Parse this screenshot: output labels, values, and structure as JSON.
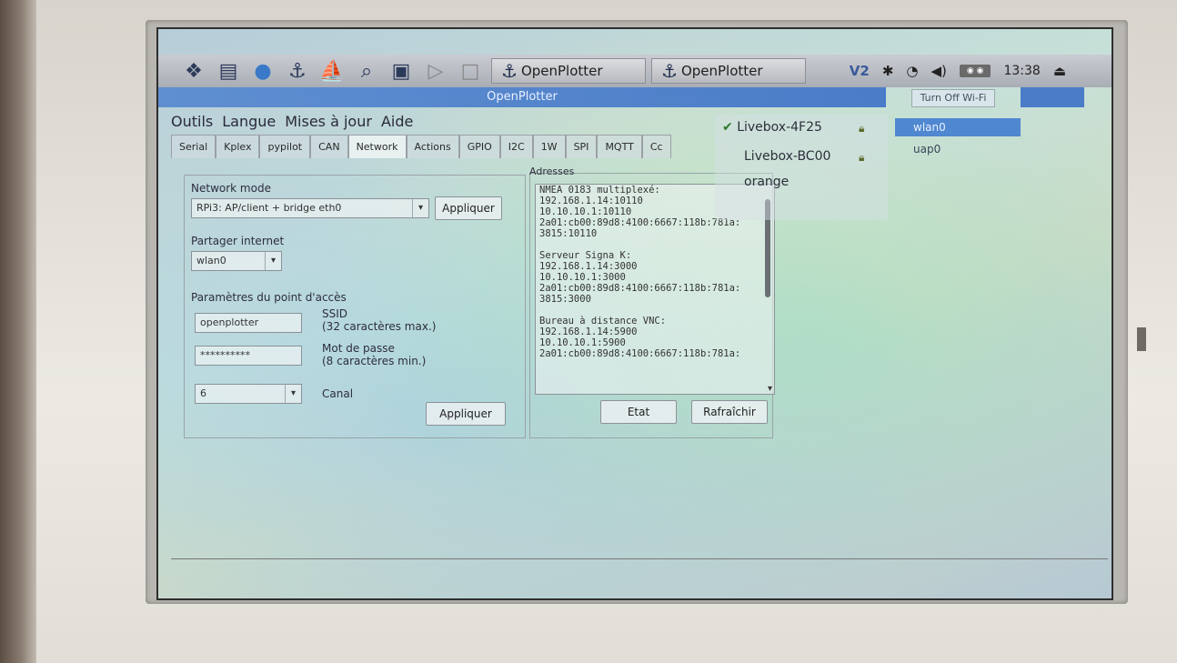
{
  "taskbar": {
    "task1": "OpenPlotter",
    "task2": "OpenPlotter",
    "tray_badge": "◉ ◉",
    "clock": "13:38"
  },
  "window": {
    "title": "OpenPlotter",
    "menu": [
      "Outils",
      "Langue",
      "Mises à jour",
      "Aide"
    ],
    "tabs": [
      "Serial",
      "Kplex",
      "pypilot",
      "CAN",
      "Network",
      "Actions",
      "GPIO",
      "I2C",
      "1W",
      "SPI",
      "MQTT",
      "Cc"
    ],
    "active_tab": "Network"
  },
  "network": {
    "mode_label": "Network mode",
    "mode_value": "RPi3: AP/client + bridge eth0",
    "apply_top": "Appliquer",
    "share_label": "Partager internet",
    "share_value": "wlan0",
    "ap_params_label": "Paramètres du point d'accès",
    "ssid_value": "openplotter",
    "ssid_label_1": "SSID",
    "ssid_label_2": "(32 caractères max.)",
    "password_value": "**********",
    "password_label_1": "Mot de passe",
    "password_label_2": "(8 caractères min.)",
    "channel_value": "6",
    "channel_label": "Canal",
    "apply_bottom": "Appliquer"
  },
  "addresses": {
    "legend": "Adresses",
    "lines": [
      "NMEA 0183 multiplexé:",
      "192.168.1.14:10110",
      "10.10.10.1:10110",
      "2a01:cb00:89d8:4100:6667:118b:781a:",
      "3815:10110",
      "",
      "Serveur Signa K:",
      "192.168.1.14:3000",
      "10.10.10.1:3000",
      "2a01:cb00:89d8:4100:6667:118b:781a:",
      "3815:3000",
      "",
      "Bureau à distance VNC:",
      "192.168.1.14:5900",
      "10.10.10.1:5900",
      "2a01:cb00:89d8:4100:6667:118b:781a:"
    ],
    "etat": "Etat",
    "refresh": "Rafraîchir"
  },
  "wifi": {
    "networks": [
      "Livebox-4F25",
      "Livebox-BC00",
      "orange"
    ],
    "turn_off": "Turn Off Wi-Fi",
    "interfaces": [
      "wlan0",
      "uap0"
    ]
  }
}
